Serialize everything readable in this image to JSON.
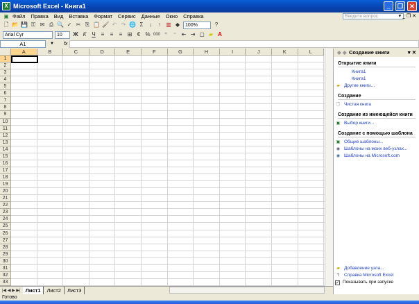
{
  "window": {
    "title": "Microsoft Excel - Книга1"
  },
  "menu": [
    "Файл",
    "Правка",
    "Вид",
    "Вставка",
    "Формат",
    "Сервис",
    "Данные",
    "Окно",
    "Справка"
  ],
  "ask_placeholder": "Введите вопрос",
  "toolbar": {
    "zoom": "100%",
    "font": "Arial Cyr",
    "size": "10",
    "bold": "Ж",
    "italic": "К",
    "underline": "Ч",
    "percent": "%",
    "thousands": "000",
    "sigma": "Σ"
  },
  "namebox": "A1",
  "fx": "fx",
  "columns": [
    "A",
    "B",
    "C",
    "D",
    "E",
    "F",
    "G",
    "H",
    "I",
    "J",
    "K",
    "L"
  ],
  "rows": [
    "1",
    "2",
    "3",
    "4",
    "5",
    "6",
    "7",
    "8",
    "9",
    "10",
    "11",
    "12",
    "13",
    "14",
    "15",
    "16",
    "17",
    "18",
    "19",
    "20",
    "21",
    "22",
    "23",
    "24",
    "25",
    "26",
    "27",
    "28",
    "29",
    "30",
    "31",
    "32",
    "33"
  ],
  "sheets": [
    "Лист1",
    "Лист2",
    "Лист3"
  ],
  "status": "Готово",
  "pane": {
    "title": "Создание книги",
    "open_header": "Открытие книги",
    "recent": [
      "Книга1",
      "Книга1"
    ],
    "more": "Другие книги...",
    "create_header": "Создание",
    "blank": "Чистая книга",
    "existing_header": "Создание из имеющейся книги",
    "choose": "Выбор книги...",
    "template_header": "Создание с помощью шаблона",
    "templates": [
      "Общие шаблоны...",
      "Шаблоны на моих веб-узлах...",
      "Шаблоны на Microsoft.com"
    ],
    "add_site": "Добавление узла...",
    "help": "Справка Microsoft Excel",
    "show_startup": "Показывать при запуске"
  }
}
